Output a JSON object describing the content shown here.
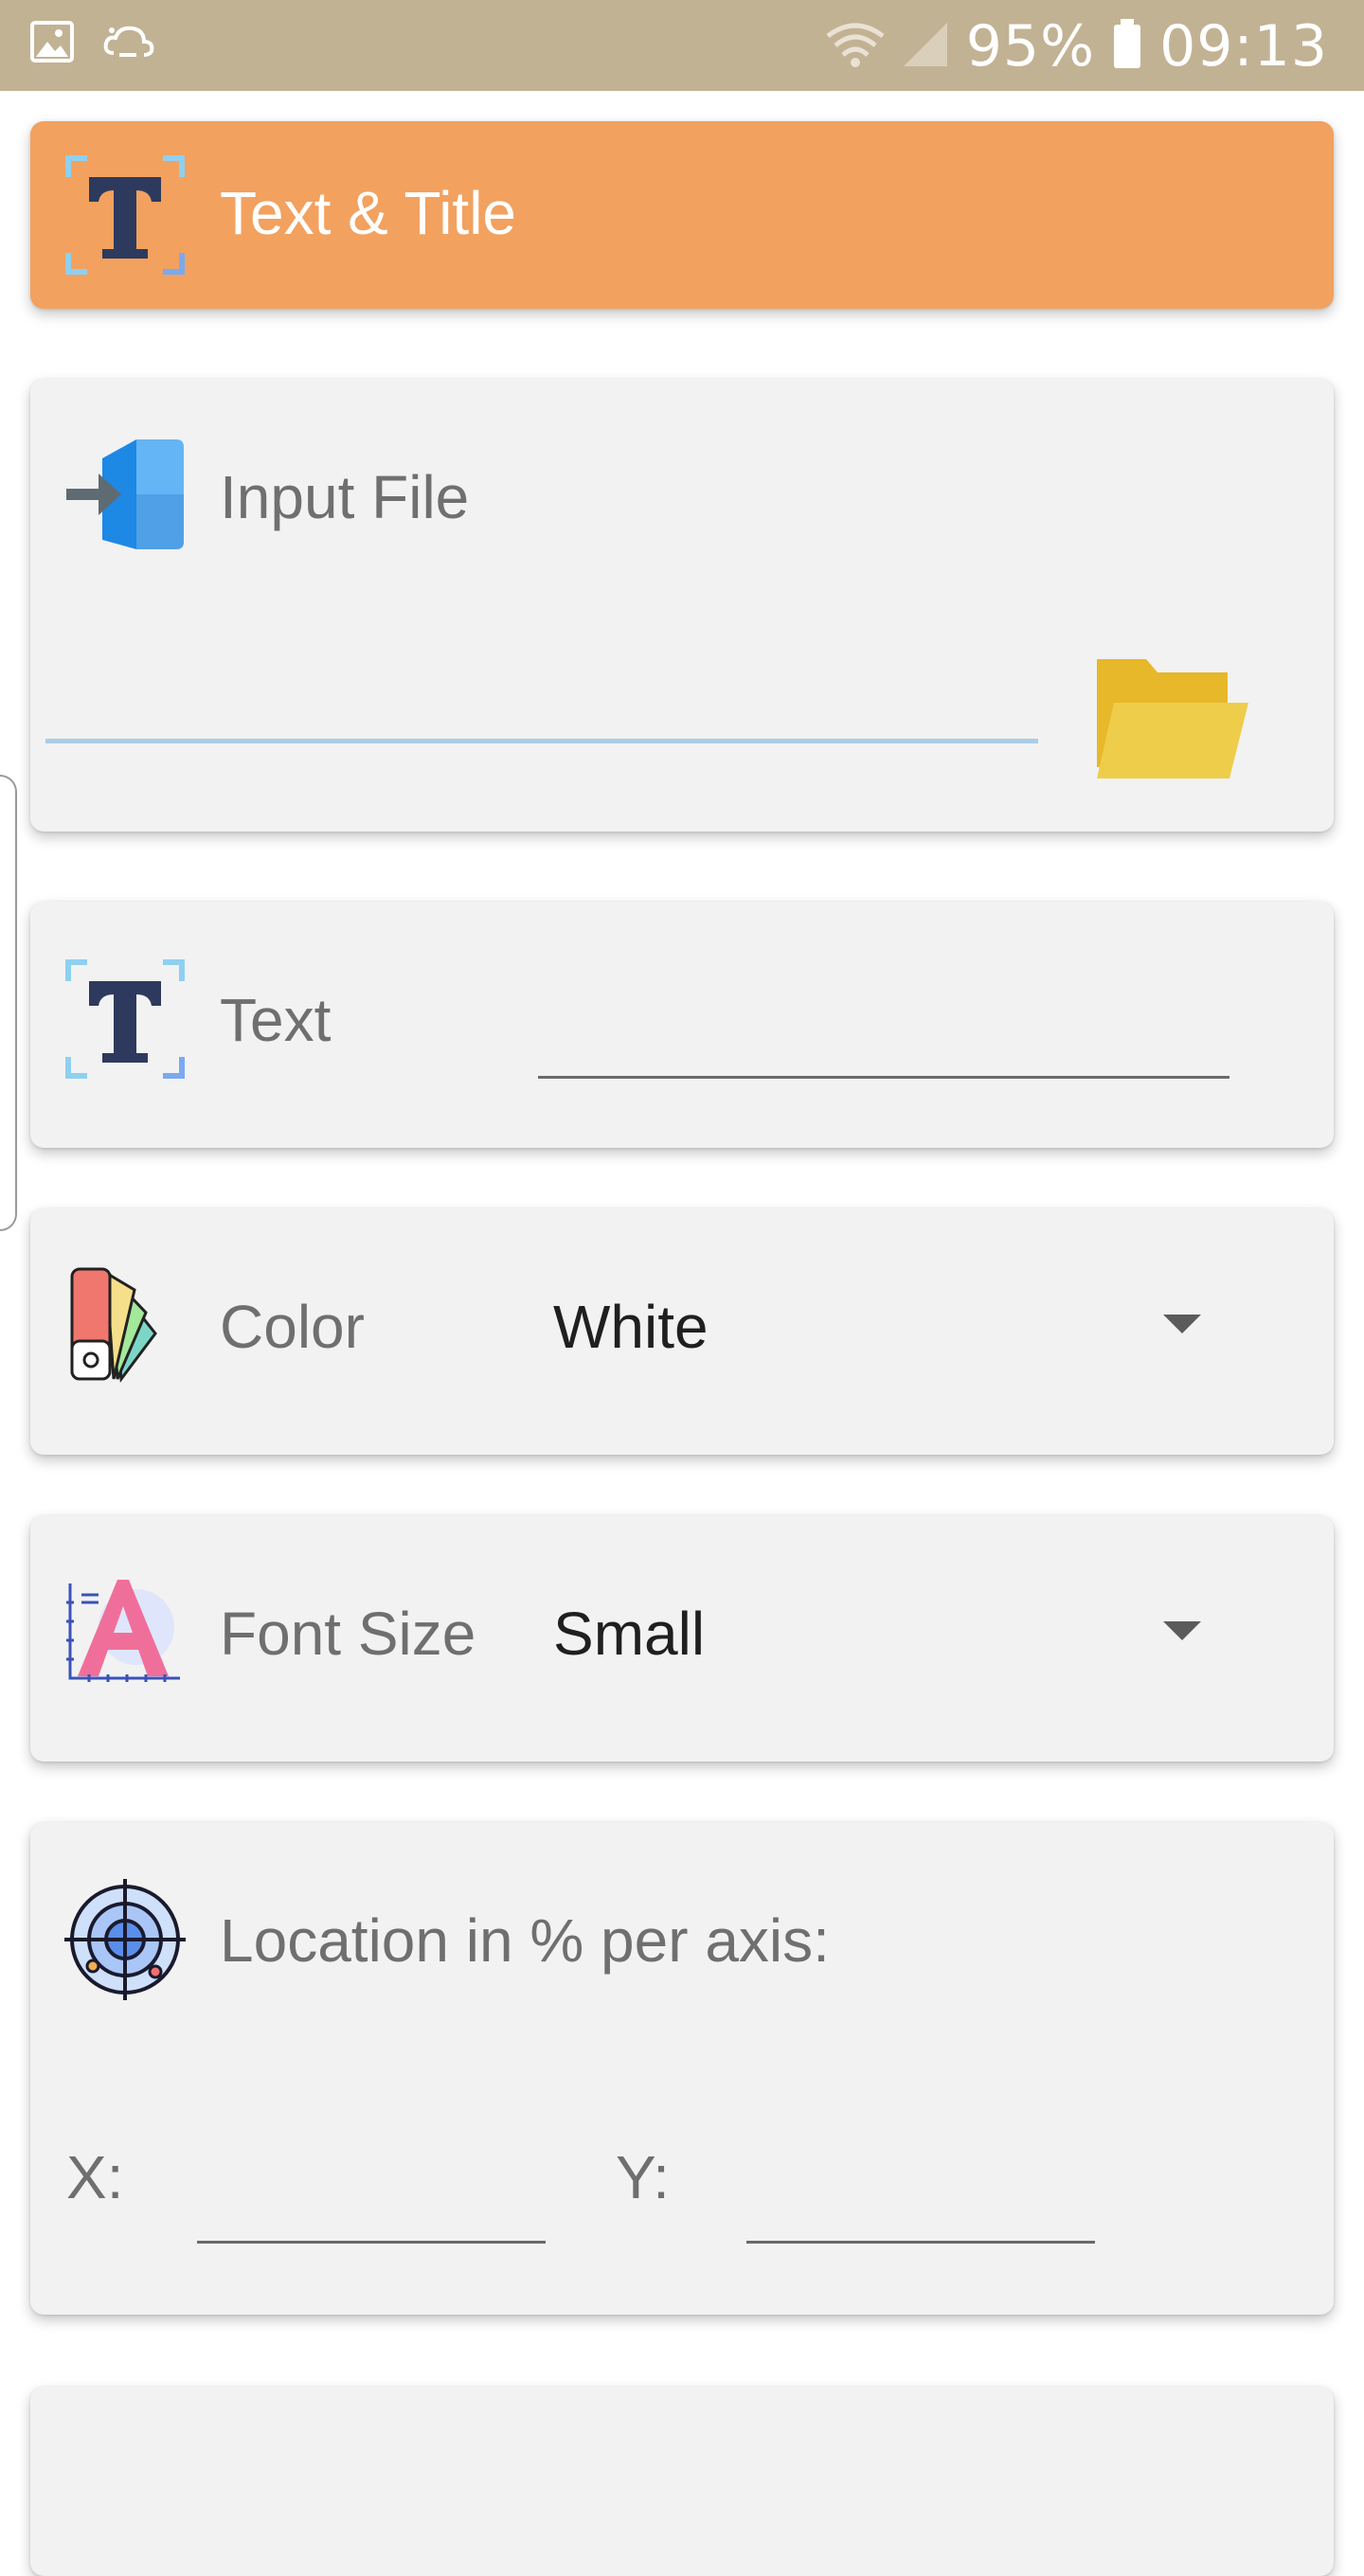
{
  "status_bar": {
    "battery": "95%",
    "time": "09:13"
  },
  "header": {
    "title": "Text & Title"
  },
  "input_file": {
    "label": "Input File",
    "value": ""
  },
  "text_field": {
    "label": "Text",
    "value": ""
  },
  "color": {
    "label": "Color",
    "selected": "White"
  },
  "font_size": {
    "label": "Font Size",
    "selected": "Small"
  },
  "location": {
    "label": "Location in % per axis:",
    "x_label": "X:",
    "x_value": "",
    "y_label": "Y:",
    "y_value": ""
  },
  "colors": {
    "accent": "#f2a15f",
    "status_bar": "#c2b294",
    "file_underline": "#a9cde6"
  },
  "icons": [
    "image-icon",
    "sync-cloud-icon",
    "wifi-icon",
    "signal-icon",
    "battery-icon",
    "text-title-icon",
    "input-file-icon",
    "folder-icon",
    "palette-icon",
    "font-size-icon",
    "target-icon",
    "dropdown-arrow-icon"
  ]
}
